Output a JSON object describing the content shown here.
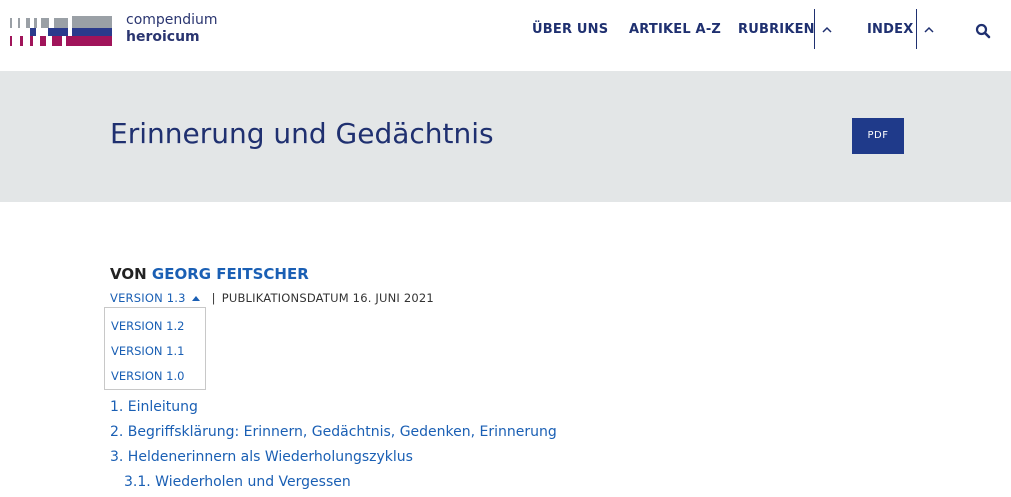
{
  "brand": {
    "line1": "compendium",
    "line2": "heroicum"
  },
  "nav": {
    "items": [
      "ÜBER UNS",
      "ARTIKEL A-Z",
      "RUBRIKEN",
      "INDEX"
    ]
  },
  "colors": {
    "primary": "#1f3a8a",
    "link": "#1a5fb4",
    "hero_bg": "#e3e6e7",
    "logo_magenta": "#a0145a",
    "logo_gray": "#9aa0a6"
  },
  "hero": {
    "title": "Erinnerung und Gedächtnis",
    "pdf_label": "PDF"
  },
  "article": {
    "author_prefix": "VON",
    "author_name": "GEORG FEITSCHER",
    "current_version": "VERSION 1.3",
    "pipe": "|",
    "published": "PUBLIKATIONSDATUM 16. JUNI 2021",
    "versions": [
      "VERSION 1.2",
      "VERSION 1.1",
      "VERSION 1.0"
    ]
  },
  "toc": [
    "1. Einleitung",
    "2. Begriffsklärung: Erinnern, Gedächtnis, Gedenken, Erinnerung",
    "3. Heldenerinnern als Wiederholungszyklus",
    "3.1. Wiederholen und Vergessen"
  ],
  "icons": {
    "search": "search-icon",
    "chevron": "chevron-up-icon"
  }
}
